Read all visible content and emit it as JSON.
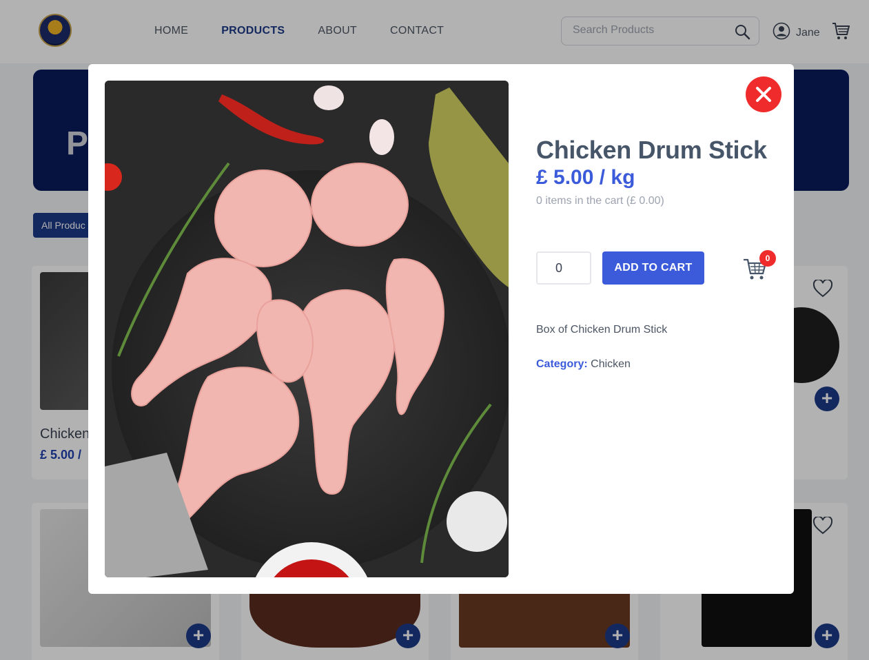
{
  "header": {
    "nav": [
      "HOME",
      "PRODUCTS",
      "ABOUT",
      "CONTACT"
    ],
    "active_nav": "PRODUCTS",
    "search_placeholder": "Search Products",
    "user_name": "Jane"
  },
  "page": {
    "hero_title_partial": "P",
    "filter_label": "All Produc",
    "card_name_partial": "Chicken",
    "card_price_partial": "£ 5.00 / "
  },
  "modal": {
    "title": "Chicken Drum Stick",
    "price": "£ 5.00 / kg",
    "cart_status": "0 items in the cart (£ 0.00)",
    "quantity": "0",
    "add_to_cart_label": "ADD TO CART",
    "cart_badge": "0",
    "description": "Box of Chicken Drum Stick",
    "category_label": "Category:",
    "category_value": "Chicken"
  },
  "colors": {
    "accent": "#3b5bdb",
    "nav_active": "#1e3a8a",
    "close": "#ef2b2b",
    "hero": "#0a1a5c"
  },
  "icons": [
    "logo",
    "search-icon",
    "user-icon",
    "cart-icon",
    "heart-icon",
    "close-icon",
    "plus-icon"
  ]
}
